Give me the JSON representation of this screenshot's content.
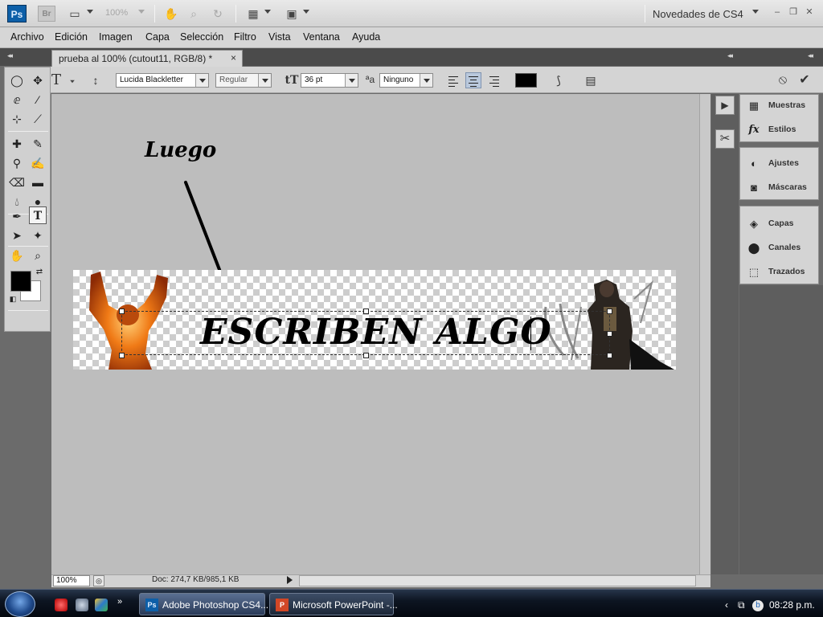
{
  "appbar": {
    "ps_logo": "Ps",
    "br_logo": "Br",
    "zoom": "100%",
    "workspace": "Novedades de CS4",
    "icons": [
      "screen-mode-icon",
      "hand-icon",
      "zoom-icon",
      "rotate-icon",
      "arrange-icon",
      "view-extras-icon"
    ]
  },
  "menu": {
    "items": [
      "Archivo",
      "Edición",
      "Imagen",
      "Capa",
      "Selección",
      "Filtro",
      "Vista",
      "Ventana",
      "Ayuda"
    ]
  },
  "document": {
    "tab_title": "prueba al 100% (cutout11, RGB/8) *",
    "close": "×",
    "zoom": "100%",
    "doc_info": "Doc: 274,7 KB/985,1 KB",
    "canvas_text": "ESCRIBEN ALGO",
    "annotation": "Luego"
  },
  "options": {
    "tool_glyph": "T",
    "font_family": "Lucida Blackletter",
    "font_style": "Regular",
    "font_size": "36 pt",
    "aa_label": "ªa",
    "antialias": "Ninguno",
    "text_color": "#000000"
  },
  "colors": {
    "foreground": "#000000",
    "background": "#ffffff",
    "accent": "#0d5fa8"
  },
  "panels": {
    "group1": [
      {
        "icon": "swatches-icon",
        "label": "Muestras"
      },
      {
        "icon": "styles-icon",
        "label": "Estilos"
      }
    ],
    "group2": [
      {
        "icon": "adjustments-icon",
        "label": "Ajustes"
      },
      {
        "icon": "masks-icon",
        "label": "Máscaras"
      }
    ],
    "group3": [
      {
        "icon": "layers-icon",
        "label": "Capas"
      },
      {
        "icon": "channels-icon",
        "label": "Canales"
      },
      {
        "icon": "paths-icon",
        "label": "Trazados"
      }
    ]
  },
  "taskbar": {
    "tasks": [
      {
        "icon": "Ps",
        "label": "Adobe Photoshop CS4..."
      },
      {
        "icon": "P",
        "label": "Microsoft PowerPoint -..."
      }
    ],
    "clock": "08:28 p.m."
  }
}
